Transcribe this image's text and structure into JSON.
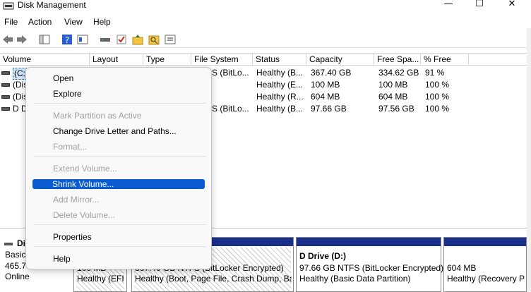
{
  "window": {
    "title": "Disk Management",
    "minimize_glyph": "—",
    "maximize_glyph": "☐",
    "close_glyph": "✕"
  },
  "menu": [
    "File",
    "Action",
    "View",
    "Help"
  ],
  "toolbar": [
    "back-arrow-icon",
    "forward-arrow-icon",
    "console-tree-icon",
    "help-icon",
    "properties-icon",
    "disk-icon",
    "check-icon",
    "folder-up-icon",
    "search-icon",
    "list-icon"
  ],
  "columns": [
    "Volume",
    "Layout",
    "Type",
    "File System",
    "Status",
    "Capacity",
    "Free Spa...",
    "% Free"
  ],
  "volumes": [
    {
      "name": "(C:",
      "fs": "S (BitLo...",
      "status": "Healthy (B...",
      "capacity": "367.40 GB",
      "free": "334.62 GB",
      "pct": "91 %"
    },
    {
      "name": "(Dis",
      "fs": "",
      "status": "Healthy (E...",
      "capacity": "100 MB",
      "free": "100 MB",
      "pct": "100 %"
    },
    {
      "name": "(Dis",
      "fs": "",
      "status": "Healthy (R...",
      "capacity": "604 MB",
      "free": "604 MB",
      "pct": "100 %"
    },
    {
      "name": "D D",
      "fs": "S (BitLo...",
      "status": "Healthy (B...",
      "capacity": "97.66 GB",
      "free": "97.56 GB",
      "pct": "100 %"
    }
  ],
  "context_menu": {
    "open": "Open",
    "explore": "Explore",
    "mark_active": "Mark Partition as Active",
    "change_letter": "Change Drive Letter and Paths...",
    "format": "Format...",
    "extend": "Extend Volume...",
    "shrink": "Shrink Volume...",
    "add_mirror": "Add Mirror...",
    "delete": "Delete Volume...",
    "properties": "Properties",
    "help": "Help"
  },
  "disk": {
    "name": "Di",
    "type": "Basic",
    "size": "465.7",
    "state": "Online"
  },
  "partitions": [
    {
      "line1": "",
      "line2": "100 MB",
      "line3": "Healthy (EFI"
    },
    {
      "line1": "",
      "line2": "367.40 GB NTFS (BitLocker Encrypted)",
      "line3": "Healthy (Boot, Page File, Crash Dump, Ba"
    },
    {
      "line1": "D Drive  (D:)",
      "line2": "97.66 GB NTFS (BitLocker Encrypted)",
      "line3": "Healthy (Basic Data Partition)"
    },
    {
      "line1": "",
      "line2": "604 MB",
      "line3": "Healthy (Recovery P"
    }
  ],
  "colors": {
    "highlight": "#0b5cd0",
    "partition_bar": "#1a2f8a",
    "selection": "#cfe3f7"
  }
}
